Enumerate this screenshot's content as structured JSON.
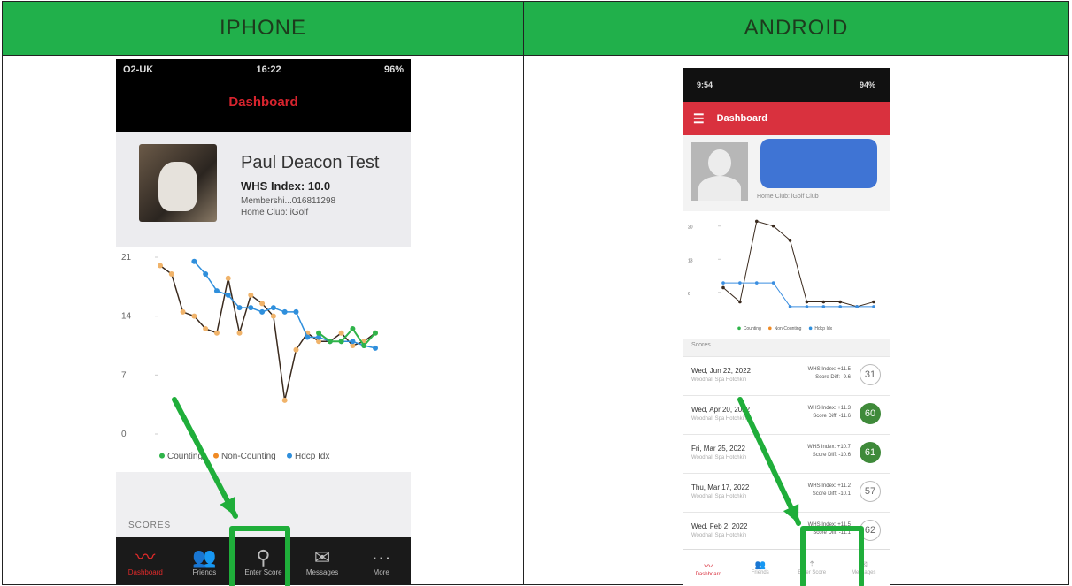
{
  "headers": {
    "left": "IPHONE",
    "right": "ANDROID"
  },
  "iphone": {
    "status": {
      "carrier": "O2-UK",
      "time": "16:22",
      "battery": "96%"
    },
    "title": "Dashboard",
    "profile": {
      "name": "Paul Deacon Test",
      "whs": "WHS Index: 10.0",
      "membership": "Membershi...016811298",
      "club": "Home Club: iGolf"
    },
    "chart_data": {
      "type": "line",
      "yticks": [
        "21",
        "14",
        "7",
        "0"
      ],
      "ylim": [
        0,
        21
      ],
      "legend": [
        "Counting",
        "Non-Counting",
        "Hdcp Idx"
      ],
      "series": [
        {
          "name": "Counting",
          "color": "#3a2a1e",
          "x": [
            1,
            2,
            3,
            4,
            5,
            6,
            7,
            8,
            9,
            10,
            11,
            12,
            13,
            14,
            15,
            16,
            17,
            18,
            19,
            20
          ],
          "values": [
            20,
            19,
            14.5,
            14,
            12.5,
            12,
            18.5,
            12,
            16.5,
            15.5,
            14,
            4,
            10,
            12,
            11,
            11,
            12,
            10.5,
            11,
            12
          ]
        },
        {
          "name": "Hdcp Idx",
          "color": "#2f8fdc",
          "x": [
            4,
            5,
            6,
            7,
            8,
            9,
            10,
            11,
            12,
            13,
            14,
            15,
            16,
            17,
            18,
            19,
            20
          ],
          "values": [
            20.5,
            19,
            17,
            16.5,
            15,
            15,
            14.5,
            15,
            14.5,
            14.5,
            11.5,
            11.5,
            11,
            11,
            11,
            10.5,
            10.2
          ]
        }
      ],
      "counting_green": {
        "x": [
          15,
          16,
          17,
          18,
          19,
          20
        ],
        "values": [
          12,
          11,
          11,
          12.5,
          10.5,
          12
        ]
      }
    },
    "scores_header": "SCORES",
    "tabs": [
      {
        "label": "Dashboard",
        "icon": "chart-line-icon"
      },
      {
        "label": "Friends",
        "icon": "friends-icon"
      },
      {
        "label": "Enter Score",
        "icon": "golf-ball-icon"
      },
      {
        "label": "Messages",
        "icon": "envelope-icon"
      },
      {
        "label": "More",
        "icon": "more-icon"
      }
    ]
  },
  "android": {
    "status": {
      "time": "9:54",
      "battery": "94%"
    },
    "title": "Dashboard",
    "club": "Home Club: iGolf Club",
    "chart_data": {
      "type": "line",
      "yticks": [
        "20",
        "13",
        "6"
      ],
      "ylim": [
        0,
        22
      ],
      "legend": [
        "Counting",
        "Non-Counting",
        "Hdcp Idx"
      ],
      "series": [
        {
          "name": "Counting",
          "color": "#3a2a1e",
          "x": [
            1,
            2,
            3,
            4,
            5,
            6,
            7,
            8,
            9,
            10
          ],
          "values": [
            7,
            4,
            21,
            20,
            17,
            4,
            4,
            4,
            3,
            4
          ]
        },
        {
          "name": "Hdcp Idx",
          "color": "#3a8ee0",
          "x": [
            1,
            2,
            3,
            4,
            5,
            6,
            7,
            8,
            9,
            10
          ],
          "values": [
            8,
            8,
            8,
            8,
            3,
            3,
            3,
            3,
            3,
            3
          ]
        }
      ]
    },
    "scores_header": "Scores",
    "rows": [
      {
        "date": "Wed, Jun 22, 2022",
        "course": "Woodhall Spa Hotchkin",
        "whs": "WHS Index: +11.5",
        "diff": "Score Diff: -9.6",
        "score": "31",
        "green": false
      },
      {
        "date": "Wed, Apr 20, 2022",
        "course": "Woodhall Spa Hotchkin",
        "whs": "WHS Index: +11.3",
        "diff": "Score Diff: -11.6",
        "score": "60",
        "green": true
      },
      {
        "date": "Fri, Mar 25, 2022",
        "course": "Woodhall Spa Hotchkin",
        "whs": "WHS Index: +10.7",
        "diff": "Score Diff: -10.6",
        "score": "61",
        "green": true
      },
      {
        "date": "Thu, Mar 17, 2022",
        "course": "Woodhall Spa Hotchkin",
        "whs": "WHS Index: +11.2",
        "diff": "Score Diff: -10.1",
        "score": "57",
        "green": false
      },
      {
        "date": "Wed, Feb 2, 2022",
        "course": "Woodhall Spa Hotchkin",
        "whs": "WHS Index: +11.5",
        "diff": "Score Diff: -11.1",
        "score": "62",
        "green": false
      }
    ],
    "tabs": [
      {
        "label": "Dashboard",
        "icon": "chart-line-icon"
      },
      {
        "label": "Friends",
        "icon": "friends-icon"
      },
      {
        "label": "Enter Score",
        "icon": "golf-tee-icon"
      },
      {
        "label": "Messages",
        "icon": "envelope-icon"
      }
    ]
  },
  "annotation_color": "#1fae3a"
}
